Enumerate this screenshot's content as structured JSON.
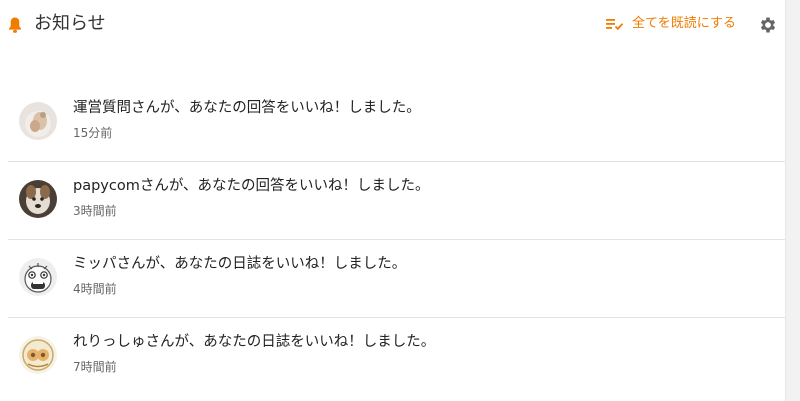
{
  "header": {
    "title": "お知らせ",
    "mark_all_read": "全てを既読にする",
    "icons": {
      "bell": "bell-icon",
      "mark_all": "mark-read-icon",
      "settings": "gear-icon"
    }
  },
  "colors": {
    "accent": "#f07c00",
    "divider": "#e3e3e3",
    "icon_gray": "#666666"
  },
  "notifications": [
    {
      "message": "運営質問さんが、あなたの回答をいいね！しました。",
      "time": "15分前"
    },
    {
      "message": "papycomさんが、あなたの回答をいいね！しました。",
      "time": "3時間前"
    },
    {
      "message": "ミッパさんが、あなたの日誌をいいね！しました。",
      "time": "4時間前"
    },
    {
      "message": "れりっしゅさんが、あなたの日誌をいいね！しました。",
      "time": "7時間前"
    }
  ]
}
